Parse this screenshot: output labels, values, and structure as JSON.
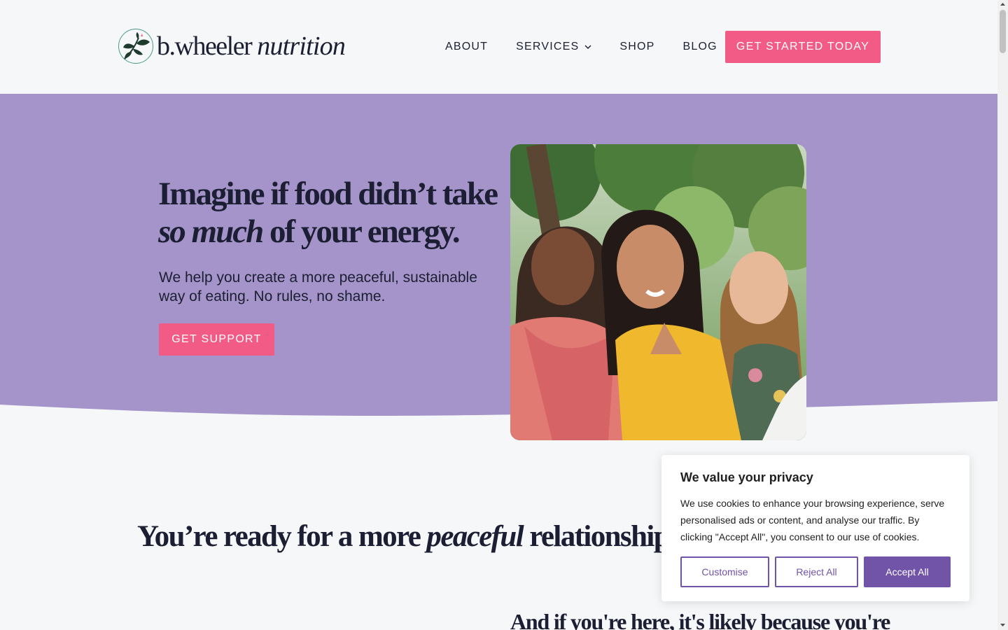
{
  "brand": {
    "name_part1": "b.wheeler",
    "name_part2": "nutrition",
    "colors": {
      "lavender": "#a594c9",
      "pink": "#f35b87",
      "purple": "#7153a8",
      "ink": "#1c1f33"
    }
  },
  "nav": {
    "items": [
      {
        "label": "ABOUT"
      },
      {
        "label": "SERVICES",
        "has_dropdown": true
      },
      {
        "label": "SHOP"
      },
      {
        "label": "BLOG"
      }
    ],
    "cta_label": "GET STARTED TODAY"
  },
  "hero": {
    "title_part1": "Imagine if food didn’t take ",
    "title_em": "so much",
    "title_part2": " of your energy.",
    "subtitle": "We help you create a more peaceful, sustainable way of eating. No rules, no shame.",
    "cta_label": "GET SUPPORT",
    "image_icon": "photo-three-women-smiling"
  },
  "section": {
    "title_part1": "You’re ready for a more ",
    "title_em": "peaceful",
    "title_part2": " relationship with food.",
    "subheading": "And if you're here, it's likely because you're"
  },
  "cookie_banner": {
    "title": "We value your privacy",
    "text": "We use cookies to enhance your browsing experience, serve personalised ads or content, and analyse our traffic. By clicking \"Accept All\", you consent to our use of cookies.",
    "customise_label": "Customise",
    "reject_label": "Reject All",
    "accept_label": "Accept All"
  }
}
